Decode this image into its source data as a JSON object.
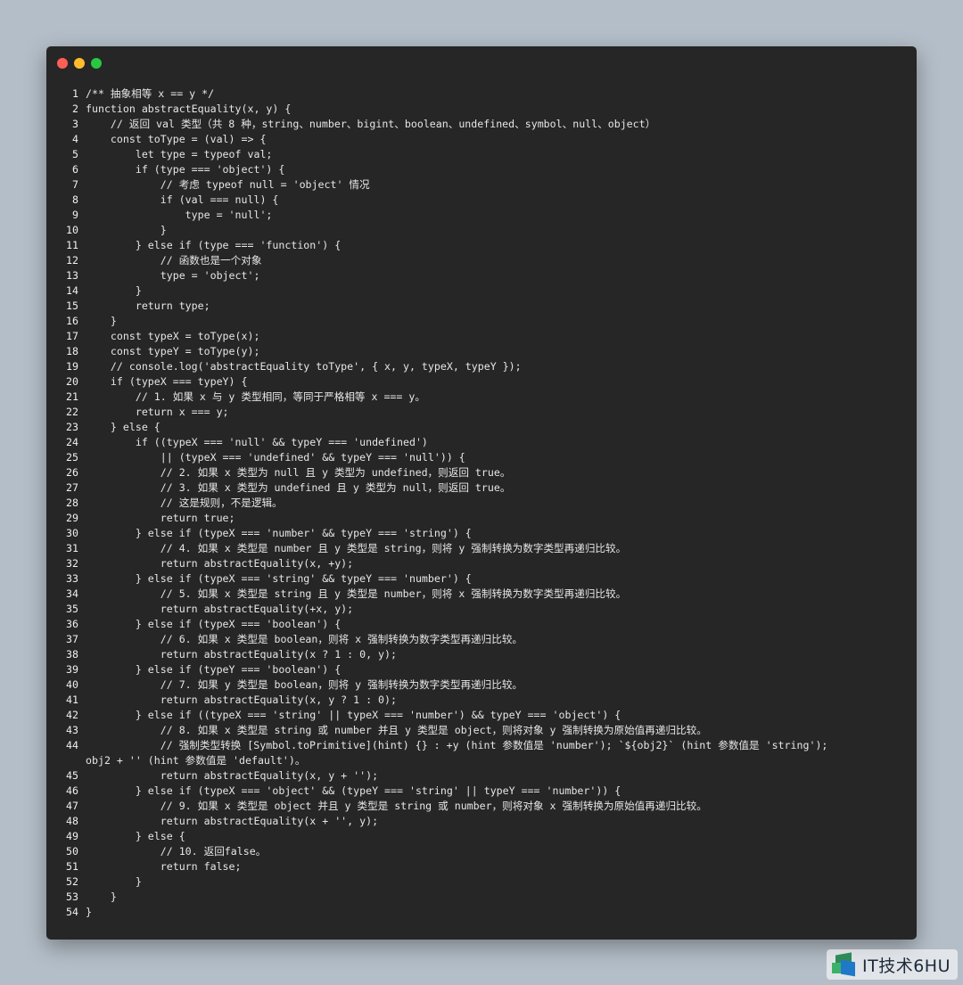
{
  "colors": {
    "background": "#b4bec8",
    "window": "#262626",
    "close": "#ff5f57",
    "minimize": "#febc2e",
    "zoom": "#28c840",
    "text": "#e6e6e6"
  },
  "window": {
    "controls": [
      {
        "name": "close",
        "icon": "red-dot-icon"
      },
      {
        "name": "minimize",
        "icon": "yellow-dot-icon"
      },
      {
        "name": "zoom",
        "icon": "green-dot-icon"
      }
    ]
  },
  "code": {
    "lines": [
      {
        "n": "1",
        "text": "/** 抽象相等 x == y */"
      },
      {
        "n": "2",
        "text": "function abstractEquality(x, y) {"
      },
      {
        "n": "3",
        "text": "    // 返回 val 类型（共 8 种，string、number、bigint、boolean、undefined、symbol、null、object）"
      },
      {
        "n": "4",
        "text": "    const toType = (val) => {"
      },
      {
        "n": "5",
        "text": "        let type = typeof val;"
      },
      {
        "n": "6",
        "text": "        if (type === 'object') {"
      },
      {
        "n": "7",
        "text": "            // 考虑 typeof null = 'object' 情况"
      },
      {
        "n": "8",
        "text": "            if (val === null) {"
      },
      {
        "n": "9",
        "text": "                type = 'null';"
      },
      {
        "n": "10",
        "text": "            }"
      },
      {
        "n": "11",
        "text": "        } else if (type === 'function') {"
      },
      {
        "n": "12",
        "text": "            // 函数也是一个对象"
      },
      {
        "n": "13",
        "text": "            type = 'object';"
      },
      {
        "n": "14",
        "text": "        }"
      },
      {
        "n": "15",
        "text": "        return type;"
      },
      {
        "n": "16",
        "text": "    }"
      },
      {
        "n": "17",
        "text": "    const typeX = toType(x);"
      },
      {
        "n": "18",
        "text": "    const typeY = toType(y);"
      },
      {
        "n": "19",
        "text": "    // console.log('abstractEquality toType', { x, y, typeX, typeY });"
      },
      {
        "n": "20",
        "text": "    if (typeX === typeY) {"
      },
      {
        "n": "21",
        "text": "        // 1. 如果 x 与 y 类型相同，等同于严格相等 x === y。"
      },
      {
        "n": "22",
        "text": "        return x === y;"
      },
      {
        "n": "23",
        "text": "    } else {"
      },
      {
        "n": "24",
        "text": "        if ((typeX === 'null' && typeY === 'undefined')"
      },
      {
        "n": "25",
        "text": "            || (typeX === 'undefined' && typeY === 'null')) {"
      },
      {
        "n": "26",
        "text": "            // 2. 如果 x 类型为 null 且 y 类型为 undefined，则返回 true。"
      },
      {
        "n": "27",
        "text": "            // 3. 如果 x 类型为 undefined 且 y 类型为 null，则返回 true。"
      },
      {
        "n": "28",
        "text": "            // 这是规则，不是逻辑。"
      },
      {
        "n": "29",
        "text": "            return true;"
      },
      {
        "n": "30",
        "text": "        } else if (typeX === 'number' && typeY === 'string') {"
      },
      {
        "n": "31",
        "text": "            // 4. 如果 x 类型是 number 且 y 类型是 string，则将 y 强制转换为数字类型再递归比较。"
      },
      {
        "n": "32",
        "text": "            return abstractEquality(x, +y);"
      },
      {
        "n": "33",
        "text": "        } else if (typeX === 'string' && typeY === 'number') {"
      },
      {
        "n": "34",
        "text": "            // 5. 如果 x 类型是 string 且 y 类型是 number，则将 x 强制转换为数字类型再递归比较。"
      },
      {
        "n": "35",
        "text": "            return abstractEquality(+x, y);"
      },
      {
        "n": "36",
        "text": "        } else if (typeX === 'boolean') {"
      },
      {
        "n": "37",
        "text": "            // 6. 如果 x 类型是 boolean，则将 x 强制转换为数字类型再递归比较。"
      },
      {
        "n": "38",
        "text": "            return abstractEquality(x ? 1 : 0, y);"
      },
      {
        "n": "39",
        "text": "        } else if (typeY === 'boolean') {"
      },
      {
        "n": "40",
        "text": "            // 7. 如果 y 类型是 boolean，则将 y 强制转换为数字类型再递归比较。"
      },
      {
        "n": "41",
        "text": "            return abstractEquality(x, y ? 1 : 0);"
      },
      {
        "n": "42",
        "text": "        } else if ((typeX === 'string' || typeX === 'number') && typeY === 'object') {"
      },
      {
        "n": "43",
        "text": "            // 8. 如果 x 类型是 string 或 number 并且 y 类型是 object，则将对象 y 强制转换为原始值再递归比较。"
      },
      {
        "n": "44",
        "text": "            // 强制类型转换 [Symbol.toPrimitive](hint) {} : +y (hint 参数值是 'number'); `${obj2}` (hint 参数值是 'string'); obj2 + '' (hint 参数值是 'default')。",
        "wrap": true
      },
      {
        "n": "45",
        "text": "            return abstractEquality(x, y + '');"
      },
      {
        "n": "46",
        "text": "        } else if (typeX === 'object' && (typeY === 'string' || typeY === 'number')) {"
      },
      {
        "n": "47",
        "text": "            // 9. 如果 x 类型是 object 并且 y 类型是 string 或 number，则将对象 x 强制转换为原始值再递归比较。"
      },
      {
        "n": "48",
        "text": "            return abstractEquality(x + '', y);"
      },
      {
        "n": "49",
        "text": "        } else {"
      },
      {
        "n": "50",
        "text": "            // 10. 返回false。"
      },
      {
        "n": "51",
        "text": "            return false;"
      },
      {
        "n": "52",
        "text": "        }"
      },
      {
        "n": "53",
        "text": "    }"
      },
      {
        "n": "54",
        "text": "}"
      }
    ]
  },
  "watermark": {
    "text": "IT技术6HU",
    "icon": "it-logo-icon"
  }
}
